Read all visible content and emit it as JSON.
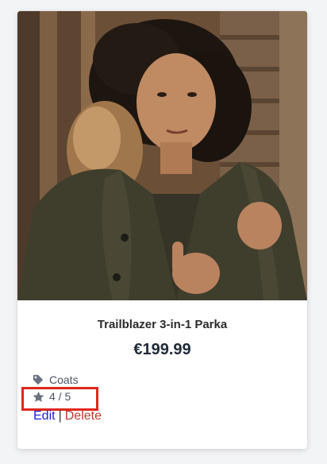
{
  "product": {
    "image_alt": "Woman wearing an olive parka with fur-trimmed hood",
    "title": "Trailblazer 3-in-1 Parka",
    "price": "€199.99",
    "category": "Coats",
    "rating": "4 / 5",
    "rating_value": 4,
    "rating_max": 5
  },
  "actions": {
    "edit_label": "Edit",
    "separator": "|",
    "delete_label": "Delete"
  },
  "icons": {
    "category": "tag-icon",
    "rating": "star-icon"
  },
  "colors": {
    "edit_link": "#1d1de0",
    "delete_link": "#c0392b",
    "highlight_box": "#e0261d"
  }
}
